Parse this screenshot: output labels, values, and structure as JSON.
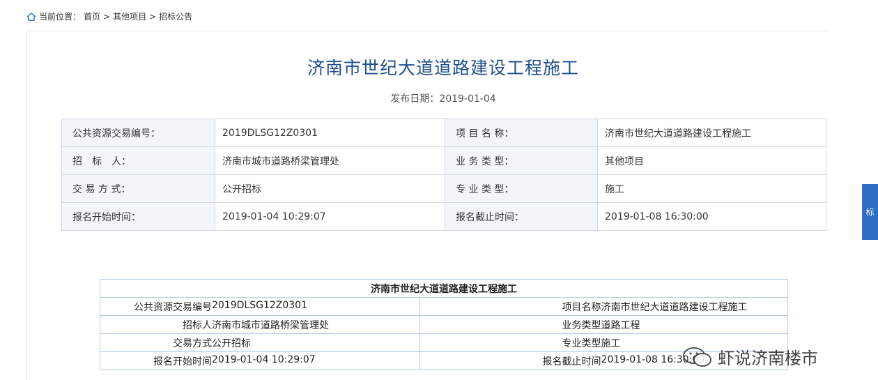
{
  "breadcrumb": {
    "prefix": "当前位置：",
    "home": "首页",
    "sep1": " >",
    "category": "其他项目",
    "sep2": ">",
    "current": "招标公告"
  },
  "title": "济南市世纪大道道路建设工程施工",
  "pubdate": "发布日期：2019-01-04",
  "info": {
    "rows": [
      {
        "l1": "公共资源交易编号：",
        "v1": "2019DLSG12Z0301",
        "l2": "项 目 名 称：",
        "v2": "济南市世纪大道道路建设工程施工"
      },
      {
        "l1": "招　标　人：",
        "v1": "济南市城市道路桥梁管理处",
        "l2": "业 务 类 型：",
        "v2": "其他项目"
      },
      {
        "l1": "交 易 方 式：",
        "v1": "公开招标",
        "l2": "专 业 类 型：",
        "v2": "施工"
      },
      {
        "l1": "报名开始时间：",
        "v1": "2019-01-04 10:29:07",
        "l2": "报名截止时间：",
        "v2": "2019-01-08 16:30:00"
      }
    ]
  },
  "sub": {
    "title": "济南市世纪大道道路建设工程施工",
    "rows": [
      {
        "k1": "公共资源交易编号",
        "v1": "2019DLSG12Z0301",
        "k2": "项目名称",
        "v2": "济南市世纪大道道路建设工程施工"
      },
      {
        "k1": "招标人",
        "v1": "济南市城市道路桥梁管理处",
        "k2": "业务类型",
        "v2": "道路工程"
      },
      {
        "k1": "交易方式",
        "v1": "公开招标",
        "k2": "专业类型",
        "v2": "施工"
      },
      {
        "k1": "报名开始时间",
        "v1": "2019-01-04 10:29:07",
        "k2": "报名截止时间",
        "v2": "2019-01-08 16:30:00"
      }
    ]
  },
  "side_tab": "标",
  "watermark": "虾说济南楼市",
  "colors": {
    "title": "#1f4f8e",
    "label_bg": "#f2f6fb",
    "side_tab": "#2e6ec4"
  }
}
